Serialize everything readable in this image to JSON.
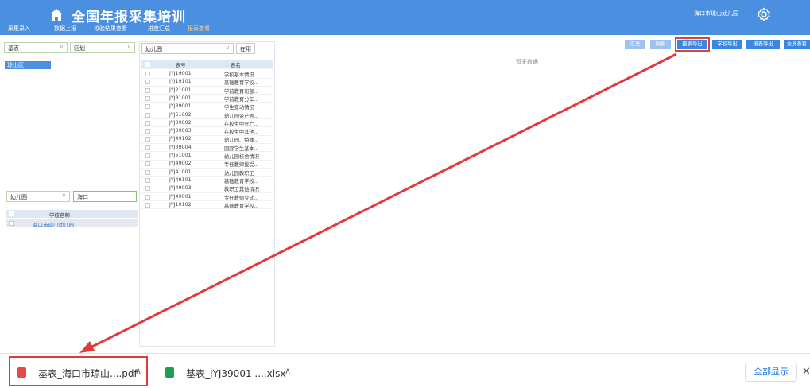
{
  "header": {
    "title": "全国年报采集培训",
    "org_name": "海口市琼山幼儿园",
    "nav": [
      "采集录入",
      "数据上报",
      "校验结果查看",
      "进度汇总",
      "报表查看"
    ]
  },
  "left_panel": {
    "type_select": "基表",
    "area_select": "区划",
    "region_item": "琼山区",
    "school_type_select": "幼儿园",
    "school_search_value": "海口",
    "school_header": "学校名称",
    "schools": [
      "海口市琼山幼儿园"
    ]
  },
  "middle_panel": {
    "kind_select": "幼儿园",
    "enable_button": "在用",
    "col_code": "表号",
    "col_name": "表名",
    "rows": [
      {
        "code": "JYJ19001",
        "name": "学校基本情况"
      },
      {
        "code": "JYJ19101",
        "name": "基础教育学校..."
      },
      {
        "code": "JYJ21001",
        "name": "学前教育班额..."
      },
      {
        "code": "JYJ31001",
        "name": "学前教育分年..."
      },
      {
        "code": "JYJ39001",
        "name": "学生变动情况"
      },
      {
        "code": "JYJ51002",
        "name": "幼儿园资产等..."
      },
      {
        "code": "JYJ39002",
        "name": "在校生中死亡..."
      },
      {
        "code": "JYJ39003",
        "name": "在校生中其他..."
      },
      {
        "code": "JYJ49102",
        "name": "幼儿园、特殊..."
      },
      {
        "code": "JYJ39004",
        "name": "国际学生基本..."
      },
      {
        "code": "JYJ51001",
        "name": "幼儿园校舍情况"
      },
      {
        "code": "JYJ49002",
        "name": "专任教师接受..."
      },
      {
        "code": "JYJ41001",
        "name": "幼儿园教职工"
      },
      {
        "code": "JYJ49101",
        "name": "基础教育学校..."
      },
      {
        "code": "JYJ49003",
        "name": "教职工其他情况"
      },
      {
        "code": "JYJ49001",
        "name": "专任教师变动..."
      },
      {
        "code": "JYJ19102",
        "name": "基础教育学校..."
      }
    ]
  },
  "toolbar": {
    "buttons": [
      "汇总",
      "刷新",
      "报表导出",
      "学校导出",
      "报表导出",
      "全屏查看"
    ],
    "empty_text": "暂无数据"
  },
  "downloads": {
    "items": [
      {
        "name": "基表_海口市琼山....pdf",
        "icon": "pdf-file-icon",
        "color": "#e34a4a"
      },
      {
        "name": "基表_JYJ39001 ....xlsx",
        "icon": "excel-file-icon",
        "color": "#1e9e52"
      }
    ],
    "show_all": "全部显示",
    "close": "✕"
  },
  "colors": {
    "header": "#4a8fe0",
    "accent": "#3a86e3",
    "highlight": "#e03a3a"
  }
}
